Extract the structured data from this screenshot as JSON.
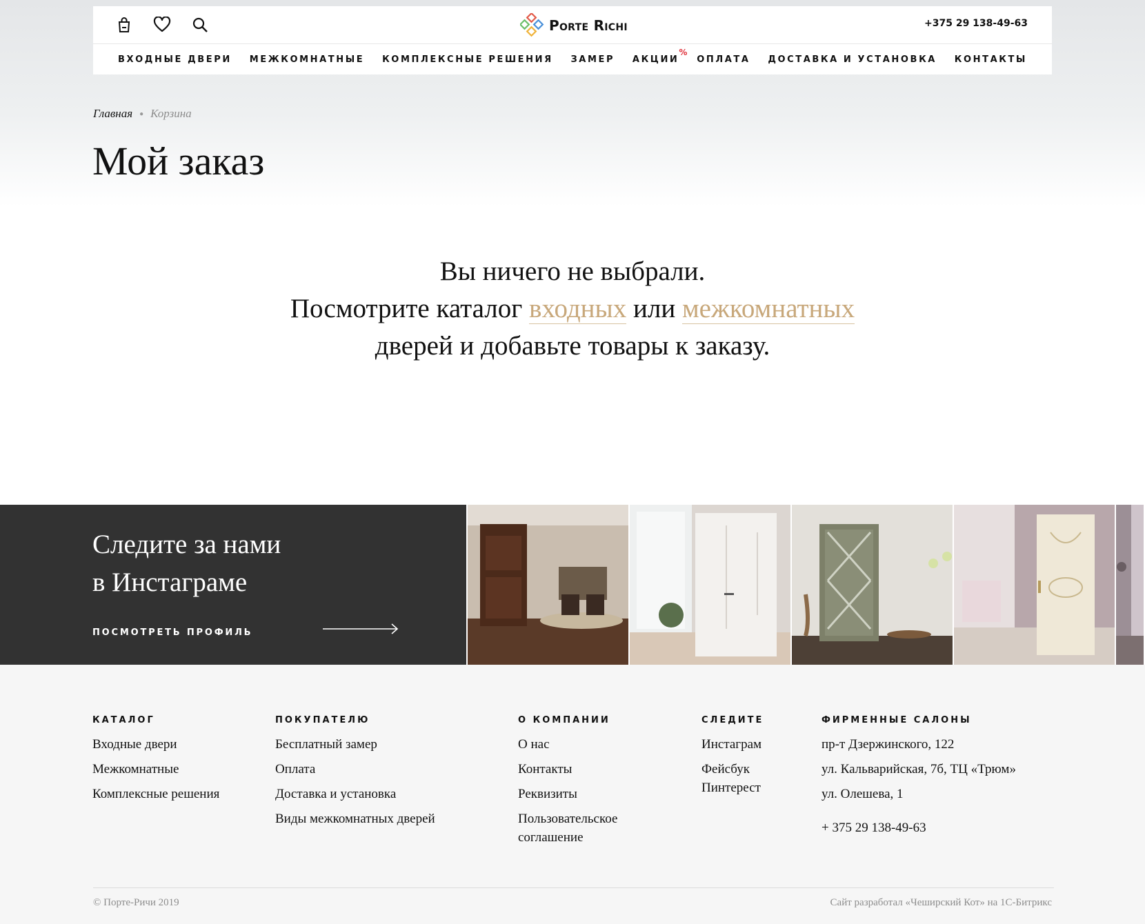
{
  "header": {
    "logo_text": "Porte Richi",
    "phone": "+375 29 138-49-63",
    "icons": [
      "cart-icon",
      "heart-icon",
      "search-icon"
    ],
    "nav": [
      {
        "label": "ВХОДНЫЕ ДВЕРИ"
      },
      {
        "label": "МЕЖКОМНАТНЫЕ"
      },
      {
        "label": "КОМПЛЕКСНЫЕ РЕШЕНИЯ"
      },
      {
        "label": "ЗАМЕР"
      },
      {
        "label": "АКЦИИ",
        "badge": "%"
      },
      {
        "label": "ОПЛАТА"
      },
      {
        "label": "ДОСТАВКА И УСТАНОВКА"
      },
      {
        "label": "КОНТАКТЫ"
      }
    ]
  },
  "breadcrumb": {
    "home": "Главная",
    "current": "Корзина"
  },
  "page": {
    "title": "Мой заказ"
  },
  "empty_cart": {
    "line1": "Вы ничего не выбрали.",
    "line2_pre": "Посмотрите каталог ",
    "link_entrance": "входных",
    "line2_mid": " или ",
    "link_interior": "межкомнатных",
    "line3": "дверей и добавьте товары к заказу."
  },
  "instagram": {
    "title_line1": "Следите за нами",
    "title_line2": "в Инстаграме",
    "profile_link": "ПОСМОТРЕТЬ ПРОФИЛЬ"
  },
  "footer": {
    "catalog": {
      "heading": "КАТАЛОГ",
      "items": [
        "Входные двери",
        "Межкомнатные",
        "Комплексные решения"
      ]
    },
    "buyer": {
      "heading": "ПОКУПАТЕЛЮ",
      "items": [
        "Бесплатный замер",
        "Оплата",
        "Доставка и установка",
        "Виды межкомнатных дверей"
      ]
    },
    "company": {
      "heading": "О КОМПАНИИ",
      "items": [
        "О нас",
        "Контакты",
        "Реквизиты",
        "Пользовательское соглашение"
      ]
    },
    "follow": {
      "heading": "СЛЕДИТЕ",
      "items": [
        "Инстаграм",
        "Фейсбук",
        "Пинтерест"
      ]
    },
    "salons": {
      "heading": "ФИРМЕННЫЕ САЛОНЫ",
      "items": [
        "пр-т Дзержинского, 122",
        "ул. Кальварийская, 7б, ТЦ «Трюм»",
        "ул. Олешева, 1"
      ],
      "phone": "+ 375 29 138-49-63"
    },
    "copyright": "© Порте-Ричи 2019",
    "credits": "Сайт разработал «Чеширский Кот» на 1С-Битрикс"
  },
  "colors": {
    "accent_gold": "#c8a87b",
    "dark_band": "#323232",
    "promo_red": "#e0323c",
    "footer_bg": "#f6f6f6"
  }
}
